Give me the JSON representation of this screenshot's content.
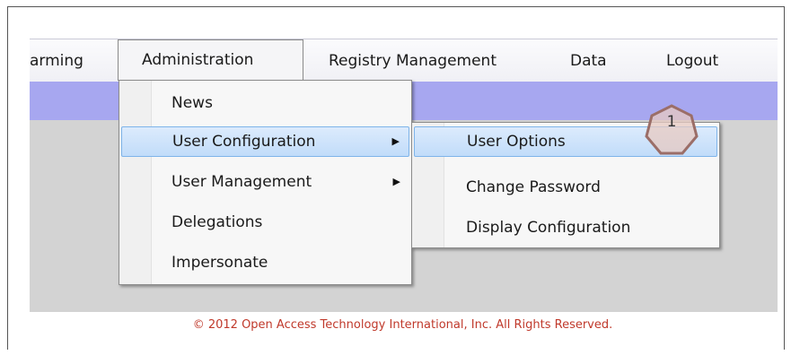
{
  "menubar": {
    "items": [
      "arming",
      "Administration",
      "Registry Management",
      "Data",
      "Logout"
    ]
  },
  "admin_menu": {
    "items": [
      "News",
      "User Configuration",
      "User Management",
      "Delegations",
      "Impersonate"
    ]
  },
  "user_config_submenu": {
    "items": [
      "User Options",
      "Change Password",
      "Display Configuration"
    ]
  },
  "callout": {
    "number": "1"
  },
  "footer": {
    "text": "© 2012 Open Access Technology International, Inc. All Rights Reserved."
  },
  "colors": {
    "banner": "#a7a7f0",
    "content_bg": "#d3d3d3",
    "highlight": "#c1dcfa",
    "footer_text": "#c0392b",
    "callout": "#b9897f"
  }
}
